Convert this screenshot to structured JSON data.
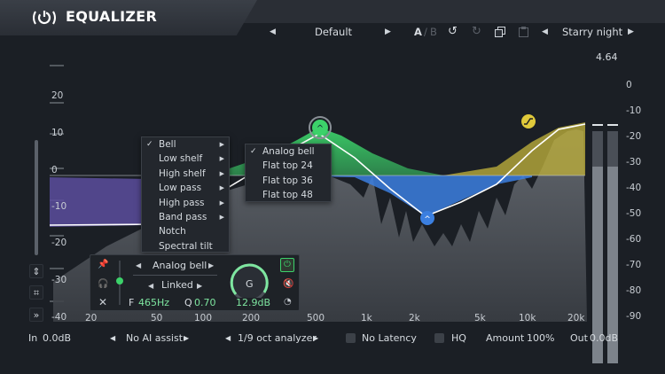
{
  "header": {
    "title": "EQUALIZER",
    "preset": "Default",
    "ab_a": "A",
    "ab_sep": "/",
    "ab_b": "B",
    "theme": "Starry night"
  },
  "plot": {
    "peak_readout": "4.64",
    "db_left": [
      "20",
      "10",
      "0",
      "-10",
      "-20",
      "-30",
      "-40"
    ],
    "db_right": [
      "0",
      "-10",
      "-20",
      "-30",
      "-40",
      "-50",
      "-60",
      "-70",
      "-80",
      "-90"
    ],
    "freq_labels": [
      "20",
      "50",
      "100",
      "200",
      "500",
      "1k",
      "2k",
      "5k",
      "10k",
      "20k"
    ],
    "band_node_glyph": "^"
  },
  "filter_menu": {
    "items": [
      "Bell",
      "Low shelf",
      "High shelf",
      "Low pass",
      "High pass",
      "Band pass",
      "Notch",
      "Spectral tilt"
    ],
    "checked": "Bell",
    "check_glyph": "✓"
  },
  "shape_menu": {
    "items": [
      "Analog bell",
      "Flat top 24",
      "Flat top 36",
      "Flat top 48"
    ],
    "checked": "Analog bell",
    "check_glyph": "✓"
  },
  "band_panel": {
    "shape": "Analog bell",
    "stereo": "Linked",
    "freq_label": "F",
    "freq_value": "465Hz",
    "q_label": "Q",
    "q_value": "0.70",
    "gain_knob_label": "G",
    "gain_value": "12.9dB"
  },
  "bottom": {
    "in_label": "In",
    "in_value": "0.0dB",
    "ai_assist": "No AI assist",
    "analyzer": "1/9 oct analyzer",
    "latency_label": "No Latency",
    "hq_label": "HQ",
    "amount_label": "Amount",
    "amount_value": "100%",
    "out_label": "Out",
    "out_value": "0.0dB"
  },
  "colors": {
    "band_green": "#3cd26a",
    "band_blue": "#3b7fe0",
    "band_yellow": "#e0c93b",
    "band_purple": "#5b4e9e"
  }
}
